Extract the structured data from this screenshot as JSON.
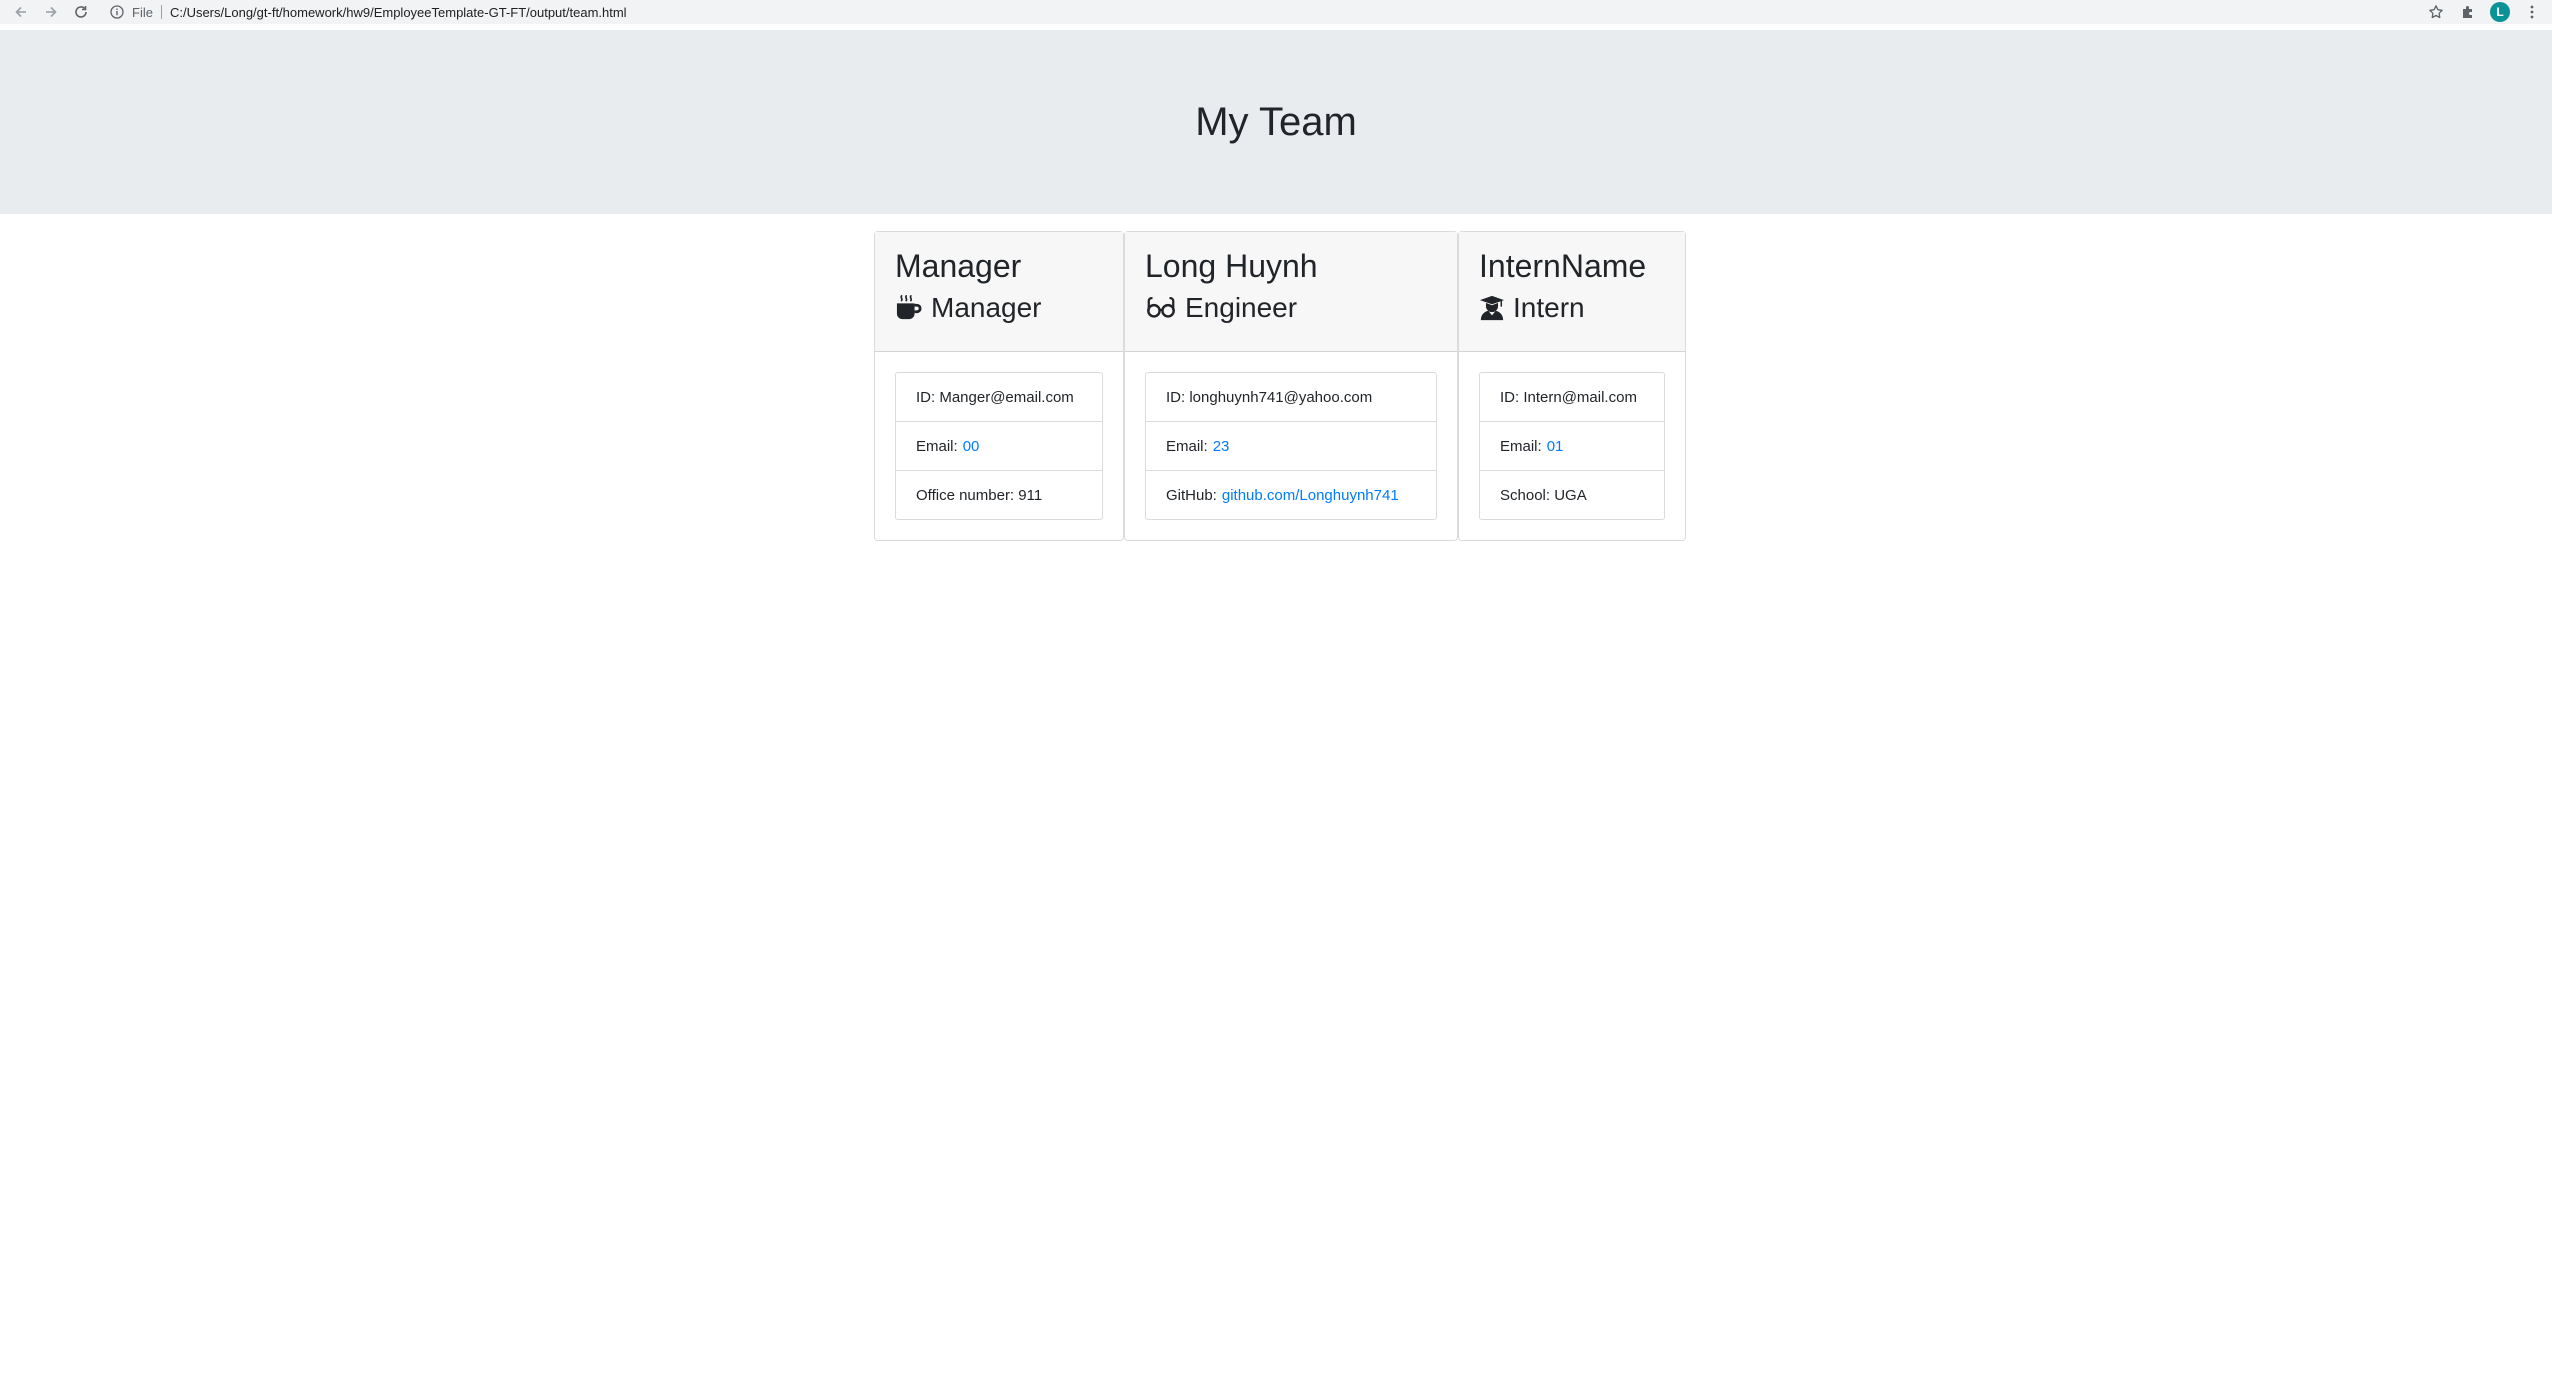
{
  "browser": {
    "file_label": "File",
    "url": "C:/Users/Long/gt-ft/homework/hw9/EmployeeTemplate-GT-FT/output/team.html",
    "avatar_letter": "L"
  },
  "page": {
    "title": "My Team"
  },
  "cards": [
    {
      "name": "Manager",
      "role": "Manager",
      "role_icon": "mug-icon",
      "id_label": "ID:",
      "id_value": "Manger@email.com",
      "email_label": "Email:",
      "email_value": "00",
      "extra_label": "Office number:",
      "extra_value": "911"
    },
    {
      "name": "Long Huynh",
      "role": "Engineer",
      "role_icon": "glasses-icon",
      "id_label": "ID:",
      "id_value": "longhuynh741@yahoo.com",
      "email_label": "Email:",
      "email_value": "23",
      "extra_label": "GitHub:",
      "extra_value": "github.com/Longhuynh741"
    },
    {
      "name": "InternName",
      "role": "Intern",
      "role_icon": "graduate-icon",
      "id_label": "ID:",
      "id_value": "Intern@mail.com",
      "email_label": "Email:",
      "email_value": "01",
      "extra_label": "School:",
      "extra_value": "UGA"
    }
  ],
  "colors": {
    "jumbotron_bg": "#e9ecef",
    "link": "#007bff",
    "card_header_bg": "#f7f7f7",
    "avatar_bg": "#0a9396"
  }
}
